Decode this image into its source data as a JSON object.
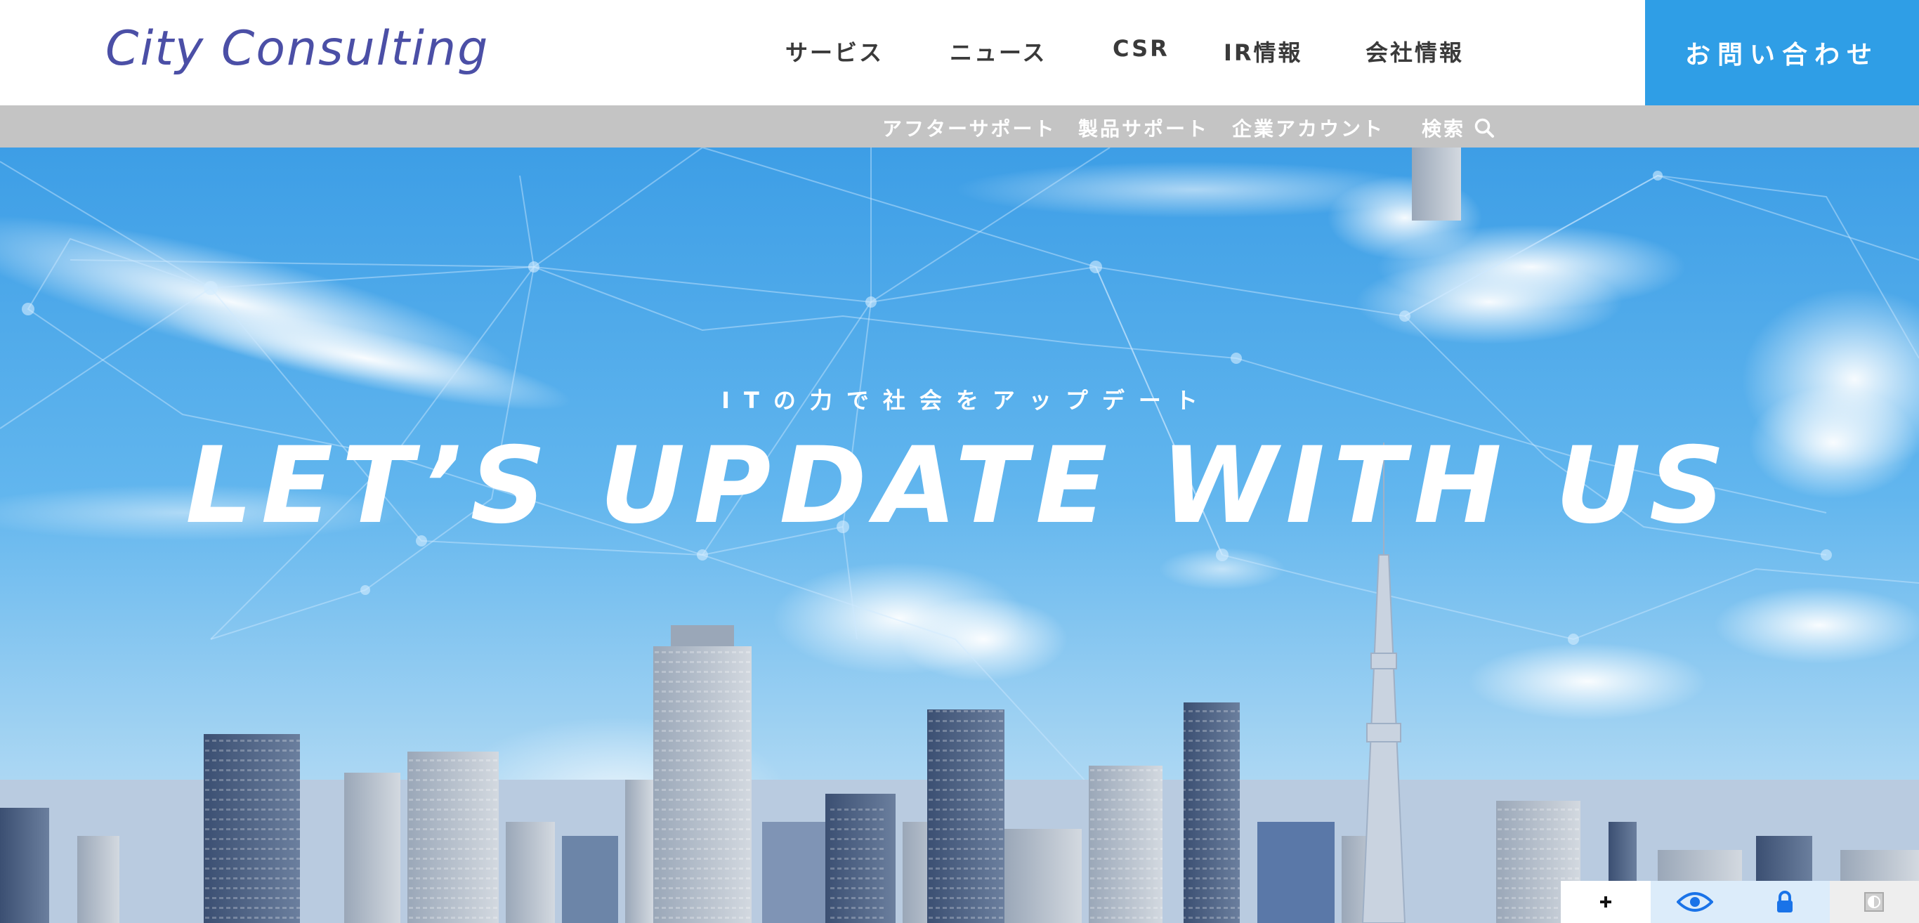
{
  "header": {
    "logo": "City Consulting",
    "nav": [
      {
        "label": "サービス"
      },
      {
        "label": "ニュース"
      },
      {
        "label": "CSR"
      },
      {
        "label": "IR情報"
      },
      {
        "label": "会社情報"
      }
    ],
    "cta_label": "お問い合わせ"
  },
  "subnav": {
    "items": [
      {
        "label": "アフターサポート"
      },
      {
        "label": "製品サポート"
      },
      {
        "label": "企業アカウント"
      }
    ],
    "search_label": "検索",
    "search_icon": "search-icon"
  },
  "hero": {
    "tagline": "ITの力で社会をアップデート",
    "headline": "LET’S UPDATE WITH US"
  },
  "a11y_toolbar": {
    "icons": [
      "plus-icon",
      "eye-icon",
      "lock-icon",
      "contrast-icon"
    ]
  },
  "colors": {
    "brand": "#4b4fa6",
    "accent": "#2f9ee6",
    "subnav_bg": "#c4c4c4"
  }
}
